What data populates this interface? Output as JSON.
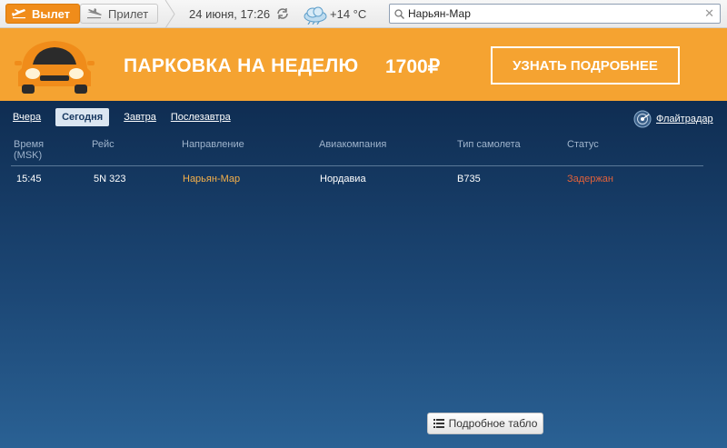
{
  "topbar": {
    "departure_label": "Вылет",
    "arrival_label": "Прилет",
    "datetime": "24 июня, 17:26",
    "temperature": "+14 °C",
    "search_value": "Нарьян-Мар",
    "icons": [
      "plane-departure-icon",
      "plane-arrival-icon",
      "refresh-icon",
      "weather-cloud-icon",
      "search-icon",
      "clear-icon"
    ]
  },
  "banner": {
    "text": "ПАРКОВКА НА НЕДЕЛЮ",
    "price": "1700₽",
    "button_label": "УЗНАТЬ ПОДРОБНЕЕ",
    "colors": {
      "background": "#f5a331",
      "car": "#f08c1a"
    }
  },
  "board": {
    "days": [
      {
        "label": "Вчера",
        "active": false
      },
      {
        "label": "Сегодня",
        "active": true
      },
      {
        "label": "Завтра",
        "active": false
      },
      {
        "label": "Послезавтра",
        "active": false
      }
    ],
    "flightradar_label": "Флайтрадар",
    "columns": {
      "time_line1": "Время",
      "time_line2": "(MSK)",
      "flight": "Рейс",
      "direction": "Направление",
      "airline": "Авиакомпания",
      "aircraft": "Тип самолета",
      "status": "Статус"
    },
    "rows": [
      {
        "time": "15:45",
        "flight": "5N 323",
        "direction": "Нарьян-Мар",
        "airline": "Нордавиа",
        "aircraft": "B735",
        "status": "Задержан"
      }
    ],
    "detail_button_label": "Подробное табло",
    "colors": {
      "destination": "#f5b04a",
      "status_delayed": "#e0613a",
      "background": "#1c4775"
    }
  }
}
